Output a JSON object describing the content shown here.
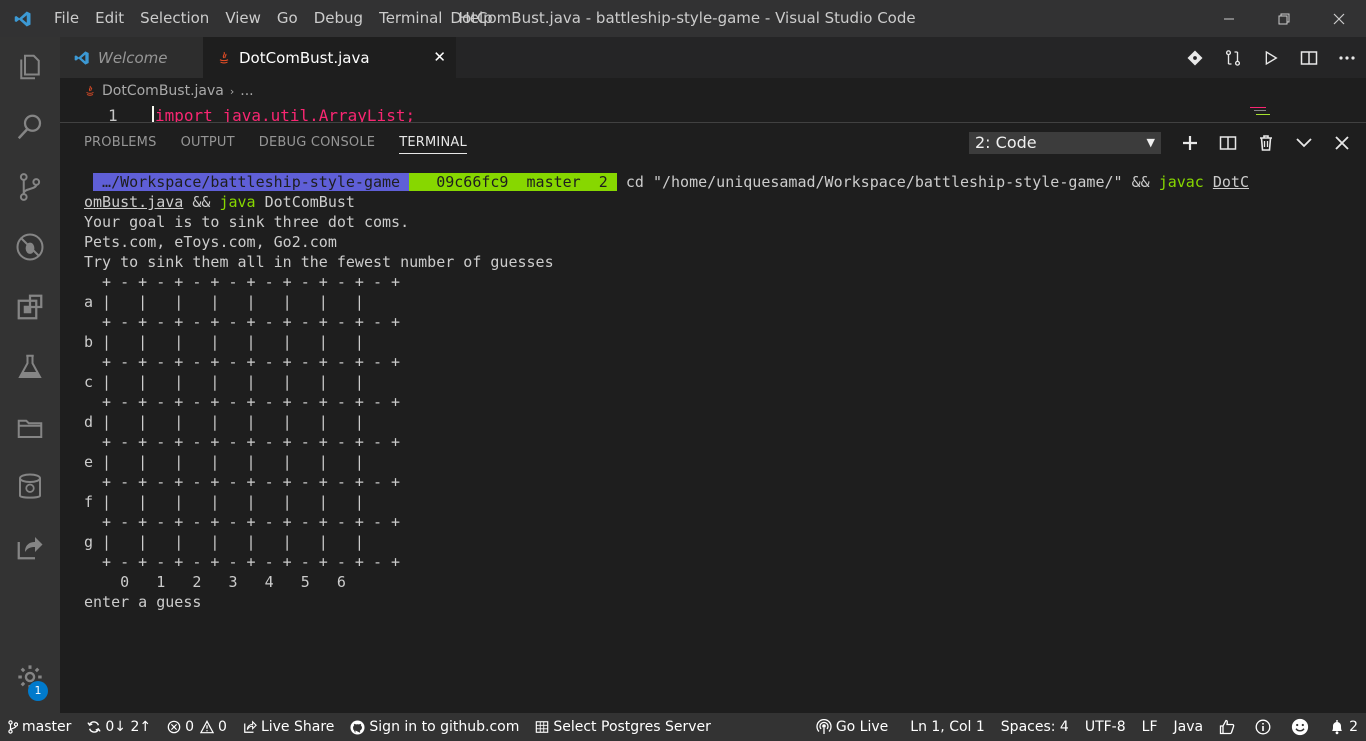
{
  "menu": [
    "File",
    "Edit",
    "Selection",
    "View",
    "Go",
    "Debug",
    "Terminal",
    "Help"
  ],
  "window_title": "DotComBust.java - battleship-style-game - Visual Studio Code",
  "activity": {
    "badge": "1"
  },
  "tabs": [
    {
      "label": "Welcome"
    },
    {
      "label": "DotComBust.java",
      "close": "✕"
    }
  ],
  "breadcrumb": {
    "file": "DotComBust.java",
    "sep": "›",
    "more": "..."
  },
  "editor": {
    "line_number": "1",
    "code": "import java.util.ArrayList;"
  },
  "panel": {
    "tabs": [
      "PROBLEMS",
      "OUTPUT",
      "DEBUG CONSOLE",
      "TERMINAL"
    ],
    "terminal_select": "2: Code"
  },
  "terminal": {
    "prompt_start": " ",
    "prompt_path": " …/Workspace/battleship-style-game ",
    "prompt_git": "   09c66fc9  master  2 ",
    "cmd_cd": " cd \"/home/uniquesamad/Workspace/battleship-style-game/\" && ",
    "cmd_javac": "javac",
    "cmd_file_a": "DotC",
    "cmd_file_b": "omBust.java",
    "cmd_and": " && ",
    "cmd_java": "java",
    "cmd_class": " DotComBust",
    "lines": [
      "Your goal is to sink three dot coms.",
      "Pets.com, eToys.com, Go2.com",
      "Try to sink them all in the fewest number of guesses",
      "  + - + - + - + - + - + - + - + - +",
      "a |   |   |   |   |   |   |   |",
      "  + - + - + - + - + - + - + - + - +",
      "b |   |   |   |   |   |   |   |",
      "  + - + - + - + - + - + - + - + - +",
      "c |   |   |   |   |   |   |   |",
      "  + - + - + - + - + - + - + - + - +",
      "d |   |   |   |   |   |   |   |",
      "  + - + - + - + - + - + - + - + - +",
      "e |   |   |   |   |   |   |   |",
      "  + - + - + - + - + - + - + - + - +",
      "f |   |   |   |   |   |   |   |",
      "  + - + - + - + - + - + - + - + - +",
      "g |   |   |   |   |   |   |   |",
      "  + - + - + - + - + - + - + - + - +",
      "    0   1   2   3   4   5   6",
      "enter a guess"
    ]
  },
  "status": {
    "branch": "master",
    "sync": "0↓ 2↑",
    "errors": "0",
    "warnings": "0",
    "live_share": "Live Share",
    "github": "Sign in to github.com",
    "postgres": "Select Postgres Server",
    "go_live": "Go Live",
    "position": "Ln 1, Col 1",
    "spaces": "Spaces: 4",
    "encoding": "UTF-8",
    "eol": "LF",
    "language": "Java",
    "notifications": "2"
  },
  "colors": {
    "accent": "#007acc",
    "titlebar": "#323233",
    "activitybar": "#333333",
    "statusbar": "#333333",
    "prompt_path_bg": "#5f5fd7",
    "prompt_git_bg": "#87d700",
    "keyword": "#f92672"
  }
}
